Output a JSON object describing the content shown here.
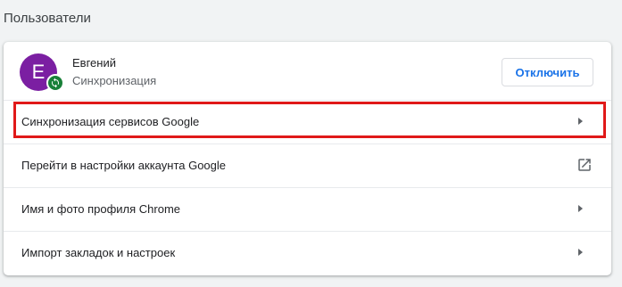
{
  "section": {
    "title": "Пользователи"
  },
  "profile": {
    "avatar_letter": "E",
    "name": "Евгений",
    "status": "Синхронизация",
    "avatar_color": "#7b1fa2",
    "badge_color": "#188038",
    "badge_icon": "sync-icon"
  },
  "disconnect_button": {
    "label": "Отключить",
    "color": "#1a73e8"
  },
  "rows": [
    {
      "label": "Синхронизация сервисов Google",
      "icon": "chevron-right-icon"
    },
    {
      "label": "Перейти в настройки аккаунта Google",
      "icon": "external-link-icon"
    },
    {
      "label": "Имя и фото профиля Chrome",
      "icon": "chevron-right-icon"
    },
    {
      "label": "Импорт закладок и настроек",
      "icon": "chevron-right-icon"
    }
  ],
  "highlight": {
    "color": "#e01919",
    "target": "Синхронизация сервисов Google"
  }
}
